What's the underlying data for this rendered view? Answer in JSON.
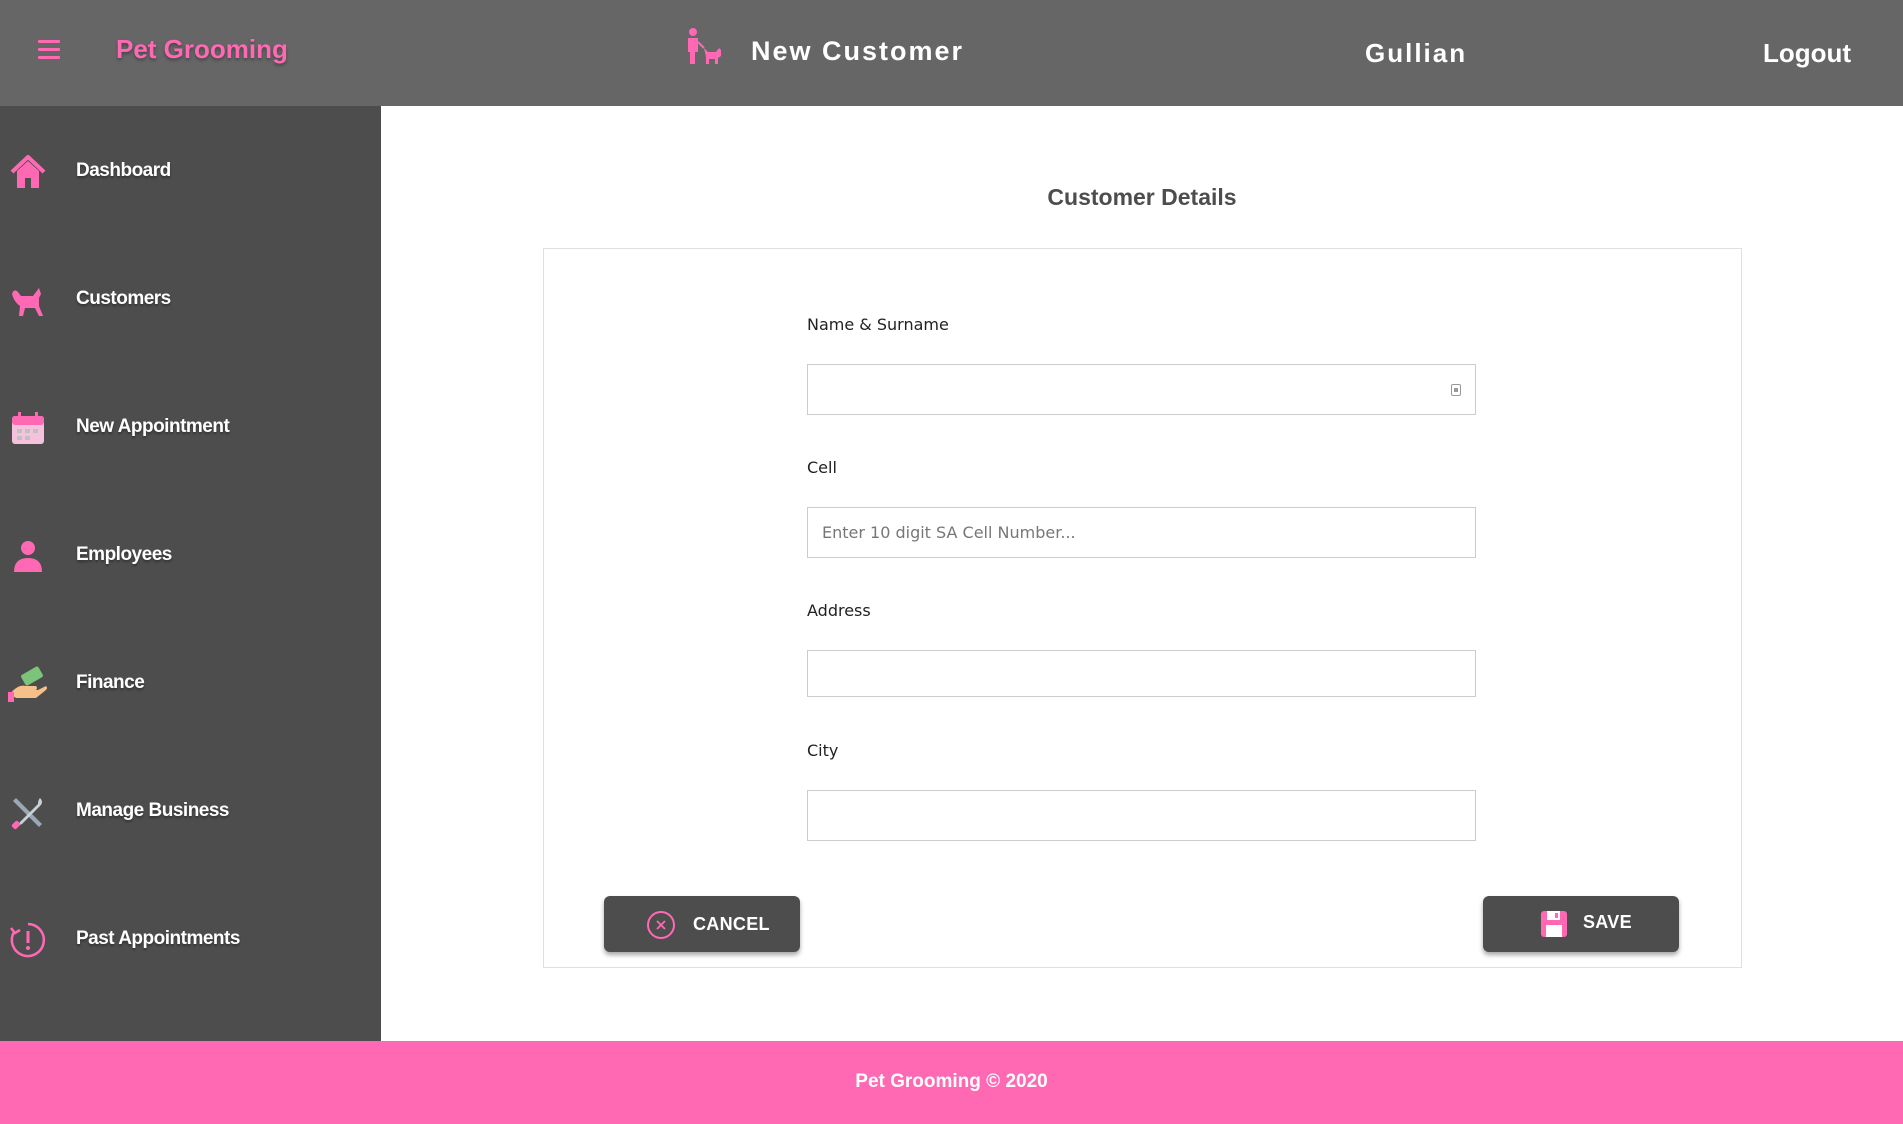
{
  "header": {
    "menu_icon": "hamburger-icon",
    "brand": "Pet Grooming",
    "page_icon": "pet-owner-icon",
    "page_title": "New Customer",
    "username": "Gullian",
    "logout": "Logout"
  },
  "sidebar": {
    "items": [
      {
        "label": "Dashboard",
        "icon": "home-icon"
      },
      {
        "label": "Customers",
        "icon": "cat-icon"
      },
      {
        "label": "New Appointment",
        "icon": "calendar-icon"
      },
      {
        "label": "Employees",
        "icon": "person-icon"
      },
      {
        "label": "Finance",
        "icon": "money-hand-icon"
      },
      {
        "label": "Manage Business",
        "icon": "tools-icon"
      },
      {
        "label": "Past Appointments",
        "icon": "history-icon"
      }
    ]
  },
  "form": {
    "title": "Customer Details",
    "fields": {
      "name": {
        "label": "Name & Surname",
        "value": "",
        "placeholder": ""
      },
      "cell": {
        "label": "Cell",
        "value": "",
        "placeholder": "Enter 10 digit SA Cell Number..."
      },
      "address": {
        "label": "Address",
        "value": "",
        "placeholder": ""
      },
      "city": {
        "label": "City",
        "value": "",
        "placeholder": ""
      }
    },
    "cancel_label": "CANCEL",
    "save_label": "SAVE"
  },
  "footer": {
    "text": "Pet Grooming © 2020"
  },
  "colors": {
    "accent": "#ff69b4",
    "header_bg": "#666666",
    "sidebar_bg": "#4d4d4d",
    "button_bg": "#4d4d4d"
  }
}
